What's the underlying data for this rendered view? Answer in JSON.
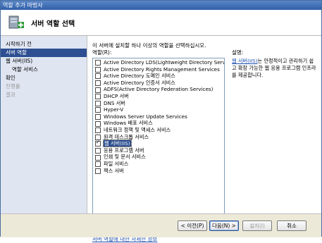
{
  "window": {
    "title": "역할 추가 마법사"
  },
  "header": {
    "title": "서버 역할 선택"
  },
  "nav": {
    "items": [
      {
        "label": "시작하기 전",
        "state": "normal",
        "sub": false
      },
      {
        "label": "서버 역할",
        "state": "active",
        "sub": false
      },
      {
        "label": "웹 서버(IIS)",
        "state": "normal",
        "sub": false
      },
      {
        "label": "역할 서비스",
        "state": "normal",
        "sub": true
      },
      {
        "label": "확인",
        "state": "normal",
        "sub": false
      },
      {
        "label": "진행률",
        "state": "disabled",
        "sub": false
      },
      {
        "label": "결과",
        "state": "disabled",
        "sub": false
      }
    ]
  },
  "main": {
    "intro": "이 서버에 설치할 하나 이상의 역할을 선택하십시오.",
    "roles_label": "역할(R):",
    "roles": [
      {
        "label": "Active Directory LDS(Lightweight Directory Services)",
        "checked": false,
        "selected": false
      },
      {
        "label": "Active Directory Rights Management Services",
        "checked": false,
        "selected": false
      },
      {
        "label": "Active Directory 도메인 서비스",
        "checked": false,
        "selected": false
      },
      {
        "label": "Active Directory 인증서 서비스",
        "checked": false,
        "selected": false
      },
      {
        "label": "ADFS(Active Directory Federation Services)",
        "checked": false,
        "selected": false
      },
      {
        "label": "DHCP 서버",
        "checked": false,
        "selected": false
      },
      {
        "label": "DNS 서버",
        "checked": false,
        "selected": false
      },
      {
        "label": "Hyper-V",
        "checked": false,
        "selected": false
      },
      {
        "label": "Windows Server Update Services",
        "checked": false,
        "selected": false
      },
      {
        "label": "Windows 배포 서비스",
        "checked": false,
        "selected": false
      },
      {
        "label": "네트워크 정책 및 액세스 서비스",
        "checked": false,
        "selected": false
      },
      {
        "label": "원격 데스크톱 서비스",
        "checked": false,
        "selected": false
      },
      {
        "label": "웹 서버(IIS)",
        "checked": true,
        "selected": true
      },
      {
        "label": "응용 프로그램 서버",
        "checked": false,
        "selected": false
      },
      {
        "label": "인쇄 및 문서 서비스",
        "checked": false,
        "selected": false
      },
      {
        "label": "파일 서비스",
        "checked": false,
        "selected": false
      },
      {
        "label": "팩스 서버",
        "checked": false,
        "selected": false
      }
    ],
    "description_label": "설명:",
    "description_link": "웹 서버(IIS)",
    "description_text": "는 안정적이고 관리하기 쉽고 확장 가능한 웹 응용 프로그램 인프라를 제공합니다.",
    "more_info_link": "서버 역할에 대한 자세한 정보"
  },
  "footer": {
    "prev": "< 이전(P)",
    "next": "다음(N) >",
    "install": "설치(I)",
    "cancel": "취소"
  },
  "colors": {
    "accent": "#2d4f91",
    "link": "#1c4fb0"
  }
}
